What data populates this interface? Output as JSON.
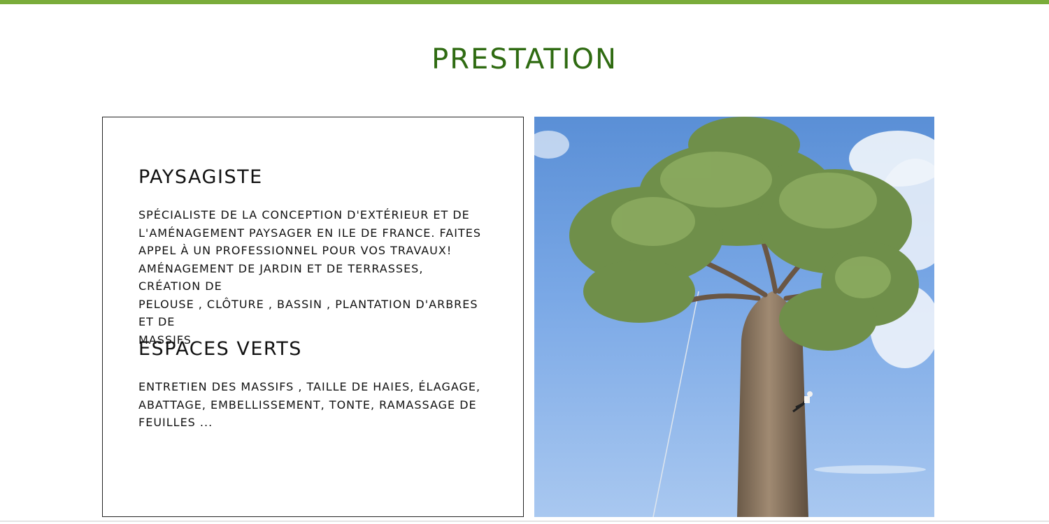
{
  "section": {
    "title": "PRESTATION"
  },
  "services": [
    {
      "heading": "PAYSAGISTE",
      "lines": [
        "Spécialiste de la conception d'extérieur et de",
        "l'aménagement paysager en Ile de France. Faites",
        "appel à  un professionnel pour vos travaux!",
        "Aménagement de jardin et de terrasses, Création de",
        "pelouse , Clôture , Bassin , Plantation d'arbres et de",
        "massifs."
      ]
    },
    {
      "heading": "ESPACES VERTS",
      "lines": [
        "Entretien des massifs , Taille de haies, Élagage,",
        "Abattage, Embellissement, Tonte, Ramassage de",
        "feuilles ..."
      ]
    }
  ],
  "photo": {
    "subject": "baobab-tree-with-climber-icon"
  },
  "colors": {
    "accent": "#7aac3a",
    "title": "#2f6b12",
    "sky": "#6f9fe0"
  }
}
